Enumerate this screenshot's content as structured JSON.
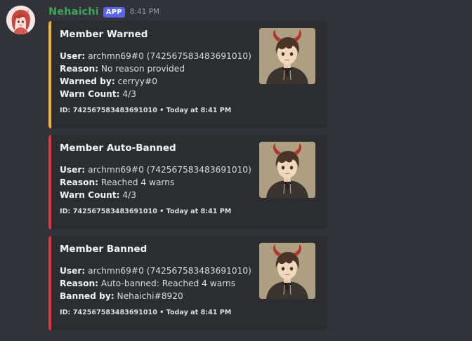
{
  "message": {
    "author": "Nehaichi",
    "badge": "APP",
    "time": "8:41 PM"
  },
  "embeds": [
    {
      "title": "Member Warned",
      "accent": "#f0b232",
      "fields": [
        {
          "label": "User:",
          "value": " archmn69#0 (742567583483691010)"
        },
        {
          "label": "Reason:",
          "value": " No reason provided"
        },
        {
          "label": "Warned by:",
          "value": " cerryy#0"
        },
        {
          "label": "Warn Count:",
          "value": " 4/3"
        }
      ],
      "footer": "ID: 742567583483691010 • Today at 8:41 PM"
    },
    {
      "title": "Member Auto-Banned",
      "accent": "#da373c",
      "fields": [
        {
          "label": "User:",
          "value": " archmn69#0 (742567583483691010)"
        },
        {
          "label": "Reason:",
          "value": " Reached 4 warns"
        },
        {
          "label": "Warn Count:",
          "value": " 4/3"
        }
      ],
      "footer": "ID: 742567583483691010 • Today at 8:41 PM"
    },
    {
      "title": "Member Banned",
      "accent": "#da373c",
      "fields": [
        {
          "label": "User:",
          "value": " archmn69#0 (742567583483691010)"
        },
        {
          "label": "Reason:",
          "value": " Auto-banned: Reached 4 warns"
        },
        {
          "label": "Banned by:",
          "value": " Nehaichi#8920"
        }
      ],
      "footer": "ID: 742567583483691010 • Today at 8:41 PM"
    }
  ],
  "colors": {
    "background": "#313338",
    "embed_background": "#2b2d31",
    "username": "#3ba55d",
    "app_badge": "#5865f2"
  },
  "icons": {
    "avatar": "anime-girl-avatar",
    "thumbnail": "anime-boy-devil-horns-thumbnail"
  }
}
